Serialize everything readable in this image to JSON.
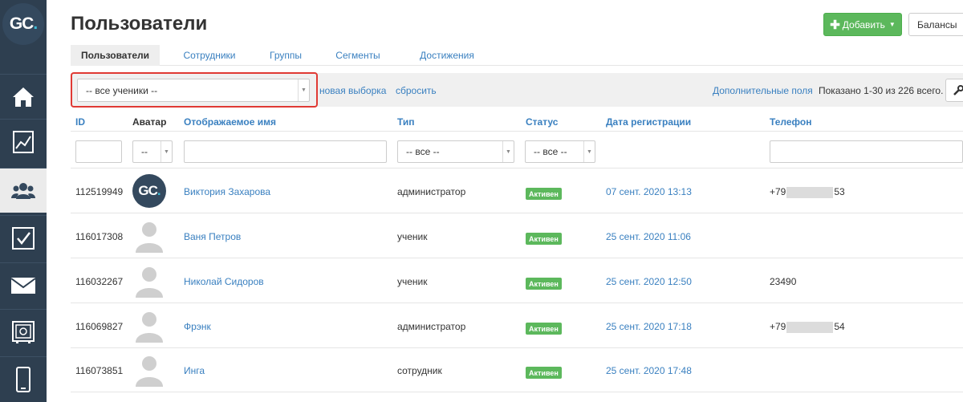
{
  "logo": {
    "text_main": "GC",
    "text_dot": "."
  },
  "sidebar": {
    "items": [
      {
        "name": "home"
      },
      {
        "name": "analytics"
      },
      {
        "name": "users",
        "active": true
      },
      {
        "name": "tasks"
      },
      {
        "name": "messages"
      },
      {
        "name": "safe"
      },
      {
        "name": "mobile"
      }
    ]
  },
  "header": {
    "title": "Пользователи",
    "add_label": "Добавить",
    "balance_label": "Балансы"
  },
  "tabs": [
    {
      "label": "Пользователи",
      "active": true
    },
    {
      "label": "Сотрудники"
    },
    {
      "label": "Группы"
    },
    {
      "label": "Сегменты"
    },
    {
      "label": "Достижения"
    }
  ],
  "filterbar": {
    "selection_value": "-- все ученики --",
    "new_selection": "новая выборка",
    "reset": "сбросить",
    "extra_fields": "Дополнительные поля",
    "shown_text": "Показано 1-30 из 226 всего."
  },
  "columns": [
    "ID",
    "Аватар",
    "Отображаемое имя",
    "Тип",
    "Статус",
    "Дата регистрации",
    "Телефон"
  ],
  "filters": {
    "avatar_value": "--",
    "type_value": "-- все --",
    "status_value": "-- все --"
  },
  "rows": [
    {
      "id": "112519949",
      "avatar": "gc",
      "name": "Виктория Захарова",
      "type": "администратор",
      "status": "Активен",
      "date": "07 сент. 2020 13:13",
      "phone_prefix": "+79",
      "phone_suffix": "53"
    },
    {
      "id": "116017308",
      "avatar": "default",
      "name": "Ваня Петров",
      "type": "ученик",
      "status": "Активен",
      "date": "25 сент. 2020 11:06",
      "phone_prefix": "",
      "phone_suffix": ""
    },
    {
      "id": "116032267",
      "avatar": "default",
      "name": "Николай Сидоров",
      "type": "ученик",
      "status": "Активен",
      "date": "25 сент. 2020 12:50",
      "phone_prefix": "23490",
      "phone_suffix": ""
    },
    {
      "id": "116069827",
      "avatar": "default",
      "name": "Фрэнк",
      "type": "администратор",
      "status": "Активен",
      "date": "25 сент. 2020 17:18",
      "phone_prefix": "+79",
      "phone_suffix": "54"
    },
    {
      "id": "116073851",
      "avatar": "default",
      "name": "Инга",
      "type": "сотрудник",
      "status": "Активен",
      "date": "25 сент. 2020 17:48",
      "phone_prefix": "",
      "phone_suffix": ""
    }
  ],
  "colors": {
    "sidebar": "#2e3f50",
    "accent": "#3a80c0",
    "success": "#5cb85c",
    "highlight": "#e03a34"
  }
}
